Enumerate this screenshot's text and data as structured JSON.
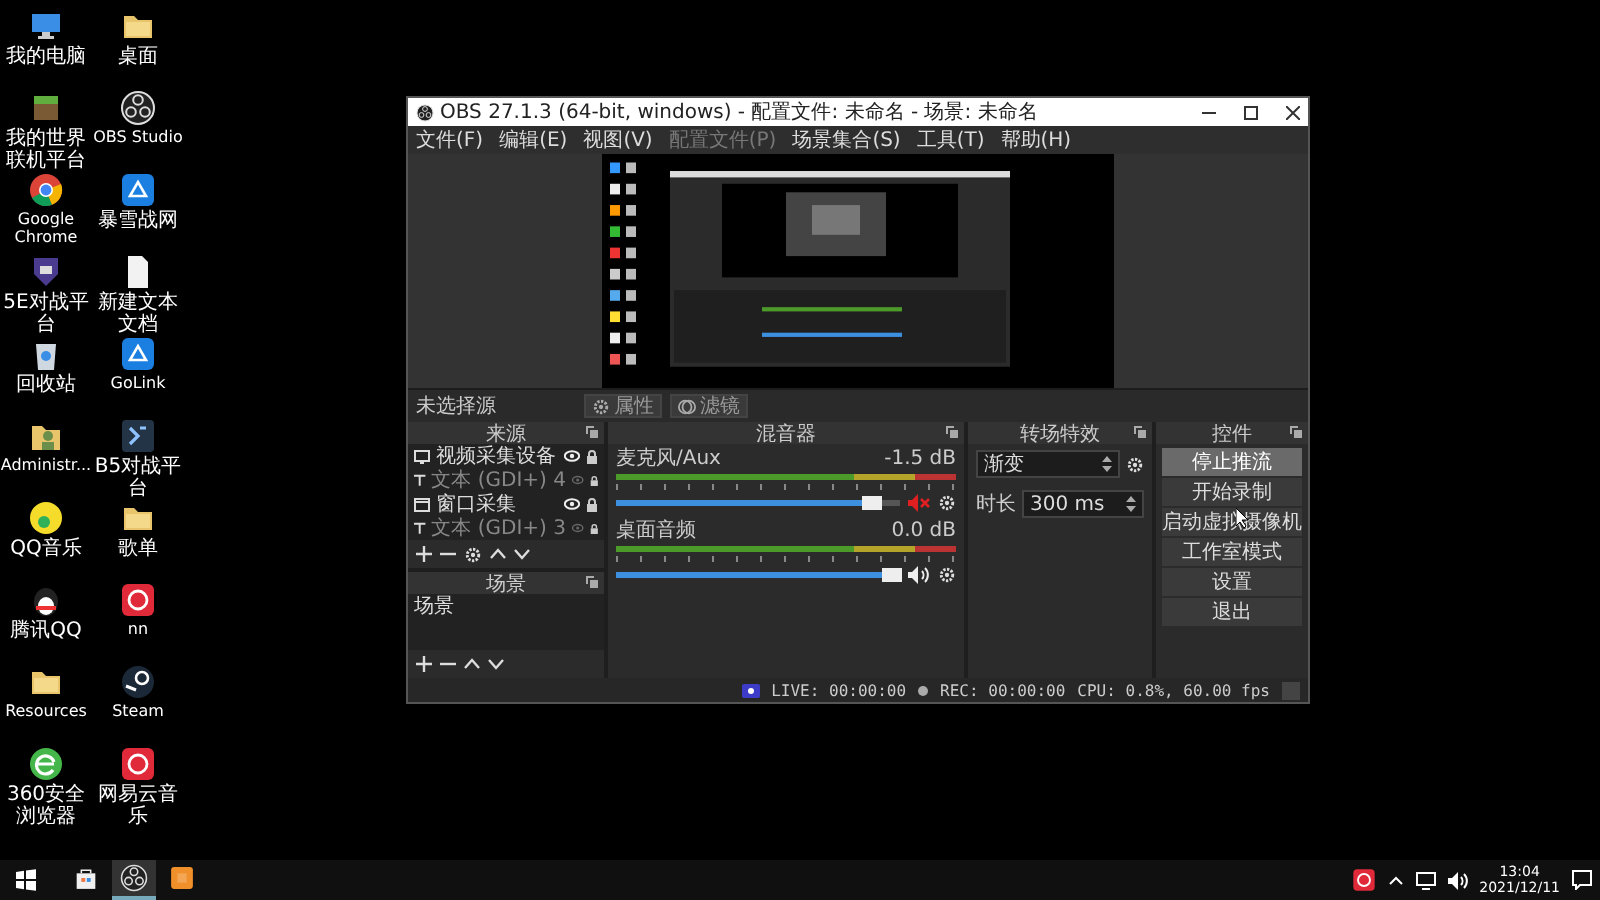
{
  "desktop": {
    "icons": [
      {
        "label": "我的电脑",
        "kind": "computer"
      },
      {
        "label": "桌面",
        "kind": "folder"
      },
      {
        "label": "我的世界联机平台",
        "kind": "block"
      },
      {
        "label": "OBS Studio",
        "kind": "obs"
      },
      {
        "label": "Google Chrome",
        "kind": "chrome"
      },
      {
        "label": "暴雪战网",
        "kind": "tile_blue"
      },
      {
        "label": "5E对战平台",
        "kind": "shield"
      },
      {
        "label": "新建文本文档",
        "kind": "document"
      },
      {
        "label": "回收站",
        "kind": "recycle"
      },
      {
        "label": "GoLink",
        "kind": "tile_blue"
      },
      {
        "label": "Administr...",
        "kind": "user_folder"
      },
      {
        "label": "B5对战平台",
        "kind": "tile_dark"
      },
      {
        "label": "QQ音乐",
        "kind": "music"
      },
      {
        "label": "歌单",
        "kind": "folder"
      },
      {
        "label": "腾讯QQ",
        "kind": "penguin"
      },
      {
        "label": "nn",
        "kind": "tile_red"
      },
      {
        "label": "Resources",
        "kind": "folder"
      },
      {
        "label": "Steam",
        "kind": "steam"
      },
      {
        "label": "360安全浏览器",
        "kind": "browser_e"
      },
      {
        "label": "网易云音乐",
        "kind": "tile_red"
      }
    ]
  },
  "window": {
    "title": "OBS 27.1.3 (64-bit, windows) - 配置文件: 未命名 - 场景: 未命名",
    "menu": [
      {
        "label": "文件(F)",
        "disabled": false
      },
      {
        "label": "编辑(E)",
        "disabled": false
      },
      {
        "label": "视图(V)",
        "disabled": false
      },
      {
        "label": "配置文件(P)",
        "disabled": true
      },
      {
        "label": "场景集合(S)",
        "disabled": false
      },
      {
        "label": "工具(T)",
        "disabled": false
      },
      {
        "label": "帮助(H)",
        "disabled": false
      }
    ],
    "source_toolbar": {
      "status": "未选择源",
      "buttons": [
        {
          "label": "属性",
          "kind": "gear"
        },
        {
          "label": "滤镜",
          "kind": "filter"
        }
      ]
    },
    "sources": {
      "title": "来源",
      "items": [
        {
          "label": "视频采集设备",
          "kind": "camera",
          "visible": true
        },
        {
          "label": "文本 (GDI+) 4",
          "kind": "text",
          "visible": false
        },
        {
          "label": "窗口采集",
          "kind": "window",
          "visible": true
        },
        {
          "label": "文本 (GDI+) 3",
          "kind": "text",
          "visible": false
        }
      ]
    },
    "scenes": {
      "title": "场景",
      "items": [
        {
          "label": "场景"
        }
      ]
    },
    "mixer": {
      "title": "混音器",
      "channels": [
        {
          "name": "麦克风/Aux",
          "reading": "-1.5 dB",
          "level": 0.9,
          "muted": true
        },
        {
          "name": "桌面音频",
          "reading": "0.0 dB",
          "level": 0.97,
          "muted": false
        }
      ]
    },
    "transitions": {
      "title": "转场特效",
      "transition": "渐变",
      "duration_label": "时长",
      "duration": "300 ms"
    },
    "controls": {
      "title": "控件",
      "buttons": [
        {
          "label": "停止推流",
          "hovered": true
        },
        {
          "label": "开始录制",
          "hovered": false
        },
        {
          "label": "启动虚拟摄像机",
          "hovered": false
        },
        {
          "label": "工作室模式",
          "hovered": false
        },
        {
          "label": "设置",
          "hovered": false
        },
        {
          "label": "退出",
          "hovered": false
        }
      ]
    },
    "status_bar": {
      "live": "LIVE: 00:00:00",
      "rec": "REC: 00:00:00",
      "cpu": "CPU: 0.8%, 60.00 fps"
    }
  },
  "taskbar": {
    "apps": [
      {
        "kind": "store",
        "active": false
      },
      {
        "kind": "obs",
        "active": true
      },
      {
        "kind": "tile_orange",
        "active": false
      }
    ],
    "time": "13:04",
    "date": "2021/12/11"
  }
}
